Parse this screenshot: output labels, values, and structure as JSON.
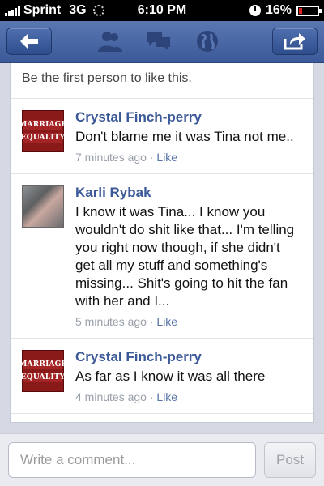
{
  "status_bar": {
    "carrier": "Sprint",
    "network": "3G",
    "time": "6:10 PM",
    "battery": "16%",
    "battery_level": 0.16,
    "battery_color": "#e22222"
  },
  "nav": {
    "back_icon": "back-arrow-icon",
    "tabs": [
      "friends-icon",
      "messages-icon",
      "globe-icon"
    ],
    "share_icon": "share-icon",
    "bar_color": "#3b5998"
  },
  "post": {
    "likes_text": "Be the first person to like this.",
    "comments": [
      {
        "author": "Crystal Finch-perry",
        "text": "Don't blame me it was Tina not me..",
        "time": "7 minutes ago",
        "sep": "·",
        "like": "Like",
        "avatar_text_1": "MARRIAGE",
        "avatar_text_2": "EQUALITY"
      },
      {
        "author": "Karli Rybak",
        "text": "I know it was Tina... I know you wouldn't do shit like that... I'm telling you right now though, if she didn't get all my stuff and something's missing... Shit's going to hit the fan with her and I...",
        "time": "5 minutes ago",
        "sep": "·",
        "like": "Like"
      },
      {
        "author": "Crystal Finch-perry",
        "text": "As far as I know it was all there",
        "time": "4 minutes ago",
        "sep": "·",
        "like": "Like",
        "avatar_text_1": "MARRIAGE",
        "avatar_text_2": "EQUALITY"
      }
    ]
  },
  "composer": {
    "placeholder": "Write a comment...",
    "post_label": "Post"
  }
}
